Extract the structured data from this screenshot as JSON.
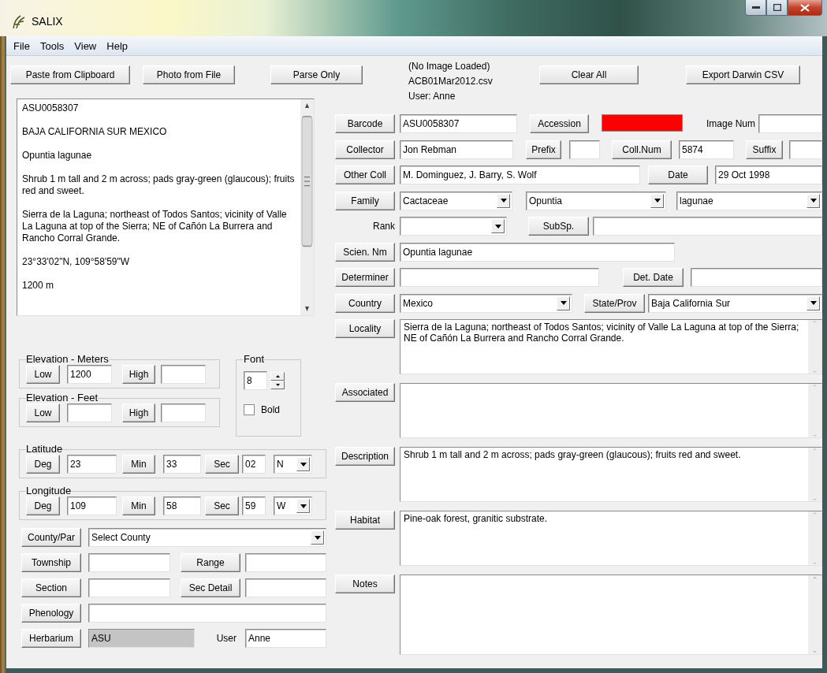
{
  "window": {
    "title": "SALIX"
  },
  "menu": [
    {
      "label": "File"
    },
    {
      "label": "Tools"
    },
    {
      "label": "View"
    },
    {
      "label": "Help"
    }
  ],
  "toolbar": {
    "left_buttons": [
      "Paste from Clipboard",
      "Photo from File",
      "Parse Only"
    ],
    "status_lines": [
      "(No Image Loaded)",
      "ACB01Mar2012.csv",
      "User:  Anne"
    ],
    "right_buttons": [
      "Clear All",
      "Export Darwin CSV"
    ]
  },
  "label_text": {
    "paragraphs": [
      "ASU0058307",
      "BAJA CALIFORNIA SUR MEXICO",
      "Opuntia lagunae",
      "Shrub 1 m tall and 2 m across; pads gray-green (glaucous); fruits red and sweet.",
      "Sierra de la Laguna; northeast of Todos Santos; vicinity of Valle La Laguna at top of the Sierra; NE of Cañón La Burrera and Rancho Corral Grande.",
      "23°33'02\"N, 109°58'59\"W",
      "1200 m"
    ]
  },
  "groups": [
    {
      "title": "Elevation - Meters",
      "items": [
        {
          "kind": "button",
          "label": "Low"
        },
        {
          "kind": "field",
          "value": "1200"
        },
        {
          "kind": "button",
          "label": "High"
        },
        {
          "kind": "field"
        }
      ]
    },
    {
      "title": "Elevation - Feet",
      "items": [
        {
          "kind": "button",
          "label": "Low"
        },
        {
          "kind": "field"
        },
        {
          "kind": "button",
          "label": "High"
        },
        {
          "kind": "field"
        }
      ]
    },
    {
      "title": "Latitude",
      "items": [
        {
          "kind": "button",
          "label": "Deg"
        },
        {
          "kind": "field",
          "value": "23"
        },
        {
          "kind": "button",
          "label": "Min"
        },
        {
          "kind": "field",
          "value": "33"
        },
        {
          "kind": "button",
          "label": "Sec"
        },
        {
          "kind": "field",
          "value": "02"
        },
        {
          "kind": "combo",
          "value": "N"
        }
      ]
    },
    {
      "title": "Longitude",
      "items": [
        {
          "kind": "button",
          "label": "Deg"
        },
        {
          "kind": "field",
          "value": "109"
        },
        {
          "kind": "button",
          "label": "Min"
        },
        {
          "kind": "field",
          "value": "58"
        },
        {
          "kind": "button",
          "label": "Sec"
        },
        {
          "kind": "field",
          "value": "59"
        },
        {
          "kind": "combo",
          "value": "W"
        }
      ]
    }
  ],
  "font_box": {
    "title": "Font",
    "size": "8",
    "bold": {
      "label": "Bold",
      "checked": false
    }
  },
  "left_rows": [
    {
      "items": [
        {
          "kind": "button",
          "label": "County/Par"
        },
        {
          "kind": "combo",
          "value": "Select County"
        }
      ]
    },
    {
      "items": [
        {
          "kind": "button",
          "label": "Township"
        },
        {
          "kind": "field",
          "disabled": false
        },
        {
          "kind": "button",
          "label": "Range"
        },
        {
          "kind": "field",
          "disabled": false
        }
      ]
    },
    {
      "items": [
        {
          "kind": "button",
          "label": "Section"
        },
        {
          "kind": "field",
          "disabled": false
        },
        {
          "kind": "button",
          "label": "Sec Detail"
        },
        {
          "kind": "field",
          "disabled": false
        }
      ]
    },
    {
      "items": [
        {
          "kind": "button",
          "label": "Phenology"
        },
        {
          "kind": "field",
          "disabled": false
        }
      ]
    },
    {
      "items": [
        {
          "kind": "button",
          "label": "Herbarium"
        },
        {
          "kind": "field",
          "value": "ASU",
          "disabled": true
        },
        {
          "kind": "label",
          "text": "User"
        },
        {
          "kind": "field",
          "value": "Anne",
          "disabled": false
        }
      ]
    }
  ],
  "right_rows": [
    {
      "items": [
        {
          "kind": "button",
          "label": "Barcode"
        },
        {
          "kind": "field",
          "value": "ASU0058307"
        },
        {
          "kind": "button",
          "label": "Accession"
        },
        {
          "kind": "swatch",
          "color": "#ff0000"
        },
        {
          "kind": "label",
          "text": "Image Num"
        },
        {
          "kind": "field"
        }
      ]
    },
    {
      "items": [
        {
          "kind": "button",
          "label": "Collector"
        },
        {
          "kind": "field",
          "value": "Jon Rebman"
        },
        {
          "kind": "button",
          "label": "Prefix"
        },
        {
          "kind": "field"
        },
        {
          "kind": "button",
          "label": "Coll.Num"
        },
        {
          "kind": "field",
          "value": "5874"
        },
        {
          "kind": "button",
          "label": "Suffix"
        },
        {
          "kind": "field"
        }
      ]
    },
    {
      "items": [
        {
          "kind": "button",
          "label": "Other Coll"
        },
        {
          "kind": "field",
          "value": "M. Dominguez, J. Barry, S. Wolf"
        },
        {
          "kind": "button",
          "label": "Date"
        },
        {
          "kind": "field",
          "value": "29 Oct 1998"
        }
      ]
    },
    {
      "items": [
        {
          "kind": "button",
          "label": "Family"
        },
        {
          "kind": "combo",
          "value": "Cactaceae"
        },
        {
          "kind": "combo",
          "value": "Opuntia"
        },
        {
          "kind": "combo",
          "value": "lagunae"
        }
      ]
    },
    {
      "items": [
        {
          "kind": "label",
          "text": "Rank"
        },
        {
          "kind": "combo"
        },
        {
          "kind": "button",
          "label": "SubSp."
        },
        {
          "kind": "field"
        }
      ]
    },
    {
      "items": [
        {
          "kind": "button",
          "label": "Scien. Nm"
        },
        {
          "kind": "field",
          "value": "Opuntia lagunae"
        }
      ]
    },
    {
      "items": [
        {
          "kind": "button",
          "label": "Determiner"
        },
        {
          "kind": "field"
        },
        {
          "kind": "button",
          "label": "Det. Date"
        },
        {
          "kind": "field"
        }
      ]
    },
    {
      "items": [
        {
          "kind": "button",
          "label": "Country"
        },
        {
          "kind": "combo",
          "value": "Mexico"
        },
        {
          "kind": "button",
          "label": "State/Prov"
        },
        {
          "kind": "combo",
          "value": "Baja California Sur"
        }
      ]
    },
    {
      "items": [
        {
          "kind": "button",
          "label": "Locality"
        },
        {
          "kind": "memo",
          "value": "Sierra de la Laguna; northeast of Todos Santos; vicinity of Valle La Laguna at top of the Sierra; NE of Cañón La Burrera and Rancho Corral Grande."
        }
      ]
    },
    {
      "items": [
        {
          "kind": "button",
          "label": "Associated"
        },
        {
          "kind": "memo"
        }
      ]
    },
    {
      "items": [
        {
          "kind": "button",
          "label": "Description"
        },
        {
          "kind": "memo",
          "value": "Shrub 1 m tall and 2 m across; pads gray-green (glaucous); fruits red and sweet."
        }
      ]
    },
    {
      "items": [
        {
          "kind": "button",
          "label": "Habitat"
        },
        {
          "kind": "memo",
          "value": "Pine-oak forest, granitic substrate."
        }
      ]
    },
    {
      "items": [
        {
          "kind": "button",
          "label": "Notes"
        },
        {
          "kind": "memo"
        }
      ]
    }
  ]
}
